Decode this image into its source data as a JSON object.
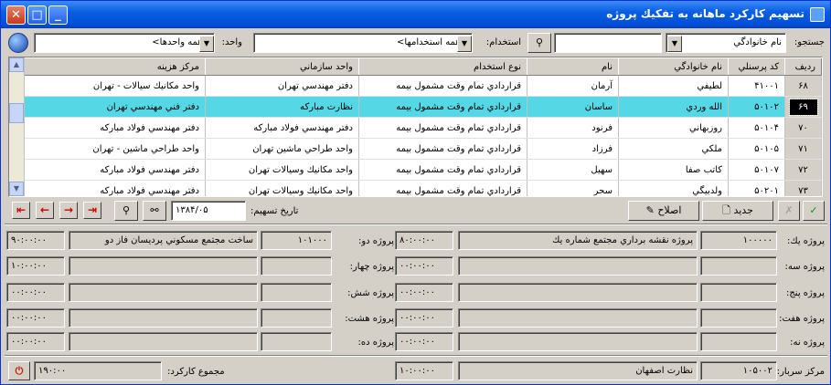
{
  "window": {
    "title": "تسهيم كاركرد ماهانه به تفكيك پروژه"
  },
  "filters": {
    "search_label": "جستجو:",
    "search_value": "نام خانوادگي",
    "employment_label": "استخدام:",
    "employment_value": "<همه استخدامها>",
    "unit_label": "واحد:",
    "unit_value": "<همه واحدها>"
  },
  "table": {
    "columns": [
      "رديف",
      "كد پرسنلي",
      "نام خانوادگي",
      "نام",
      "نوع استخدام",
      "واحد سازماني",
      "مركز هزينه"
    ],
    "rows": [
      {
        "row": "۶۸",
        "code": "۴۱۰۰۱",
        "last": "لطيفي",
        "first": "آرمان",
        "type": "قراردادي تمام وقت مشمول بيمه",
        "unit": "دفتر مهندسي تهران",
        "cost": "واحد مكانيك سيالات - تهران"
      },
      {
        "row": "۶۹",
        "code": "۵۰۱۰۲",
        "last": "الله وردي",
        "first": "ساسان",
        "type": "قراردادي تمام وقت مشمول بيمه",
        "unit": "نظارت مباركه",
        "cost": "دفتر فني مهندسي تهران"
      },
      {
        "row": "۷۰",
        "code": "۵۰۱۰۴",
        "last": "روزبهاني",
        "first": "فرنود",
        "type": "قراردادي تمام وقت مشمول بيمه",
        "unit": "دفتر مهندسي فولاد مباركه",
        "cost": "دفتر مهندسي فولاد مباركه"
      },
      {
        "row": "۷۱",
        "code": "۵۰۱۰۵",
        "last": "ملكي",
        "first": "فرزاد",
        "type": "قراردادي تمام وقت مشمول بيمه",
        "unit": "واحد طراحي ماشين تهران",
        "cost": "واحد طراحي ماشين - تهران"
      },
      {
        "row": "۷۲",
        "code": "۵۰۱۰۷",
        "last": "كاتب صفا",
        "first": "سهيل",
        "type": "قراردادي تمام وقت مشمول بيمه",
        "unit": "واحد مكانيك وسيالات تهران",
        "cost": "دفتر مهندسي فولاد مباركه"
      },
      {
        "row": "۷۳",
        "code": "۵۰۲۰۱",
        "last": "ولدبيگي",
        "first": "سحر",
        "type": "قراردادي تمام وقت مشمول بيمه",
        "unit": "واحد مكانيك وسيالات تهران",
        "cost": "دفتر مهندسي فولاد مباركه"
      }
    ]
  },
  "toolbar": {
    "new_label": "جديد",
    "edit_label": "اصلاح",
    "date_label": "تاريخ تسهيم:",
    "date_value": "۱۳۸۴/۰۵"
  },
  "projects": {
    "p1": {
      "label": "پروژه يك:",
      "code": "۱۰۰۰۰۰",
      "name": "پروژه نقشه برداري مجتمع شماره يك",
      "hours": "۸۰:۰۰:۰۰"
    },
    "p2": {
      "label": "پروژه دو:",
      "code": "۱۰۱۰۰۰",
      "name": "ساخت مجتمع مسكوني پرديسان فاز دو",
      "hours": "۹۰:۰۰:۰۰"
    },
    "p3": {
      "label": "پروژه سه:",
      "hours": "۰۰:۰۰:۰۰"
    },
    "p4": {
      "label": "پروژه چهار:",
      "hours": "۱۰:۰۰:۰۰"
    },
    "p5": {
      "label": "پروژه پنج:",
      "hours": "۰۰:۰۰:۰۰"
    },
    "p6": {
      "label": "پروژه شش:",
      "hours": "۰۰:۰۰:۰۰"
    },
    "p7": {
      "label": "پروژه هفت:",
      "hours": "۰۰:۰۰:۰۰"
    },
    "p8": {
      "label": "پروژه هشت:",
      "hours": "۰۰:۰۰:۰۰"
    },
    "p9": {
      "label": "پروژه نه:",
      "hours": "۰۰:۰۰:۰۰"
    },
    "p10": {
      "label": "پروژه ده:",
      "hours": "۰۰:۰۰:۰۰"
    }
  },
  "overhead": {
    "label": "مركز سربار:",
    "code": "۱۰۵۰۰۲",
    "name": "نظارت اصفهان",
    "hours": "۱۰:۰۰:۰۰"
  },
  "total": {
    "label": "مجموع كاركرد:",
    "value": "۱۹۰:۰۰"
  }
}
